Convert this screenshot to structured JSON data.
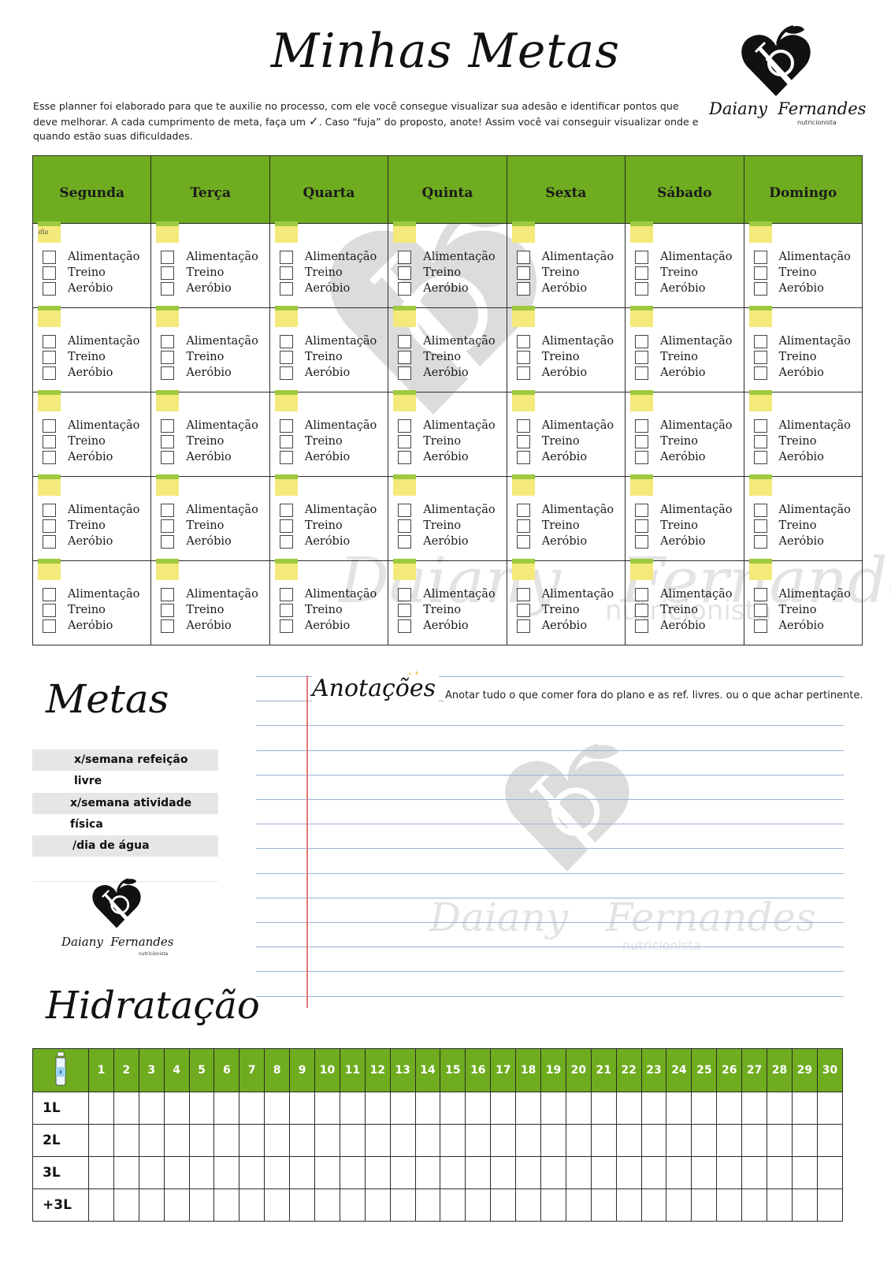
{
  "title": "Minhas Metas",
  "intro": {
    "part1": "Esse planner foi elaborado para que te auxilie no processo, com ele você consegue visualizar sua adesão e identificar pontos que deve melhorar. A cada cumprimento de meta, faça um ",
    "check_icon": "checkmark-icon",
    "part2": ". Caso “fuja” do proposto, anote! Assim você vai conseguir visualizar onde e quando estão suas dificuldades."
  },
  "logo": {
    "first_name": "Daiany",
    "last_name": "Fernandes",
    "subtitle": "nutricionista",
    "icon": "heart-fork-knife-icon"
  },
  "week": {
    "days": [
      "Segunda",
      "Terça",
      "Quarta",
      "Quinta",
      "Sexta",
      "Sábado",
      "Domingo"
    ],
    "items": [
      "Alimentação",
      "Treino",
      "Aeróbio"
    ],
    "rows": 5,
    "day_tag": "dia"
  },
  "metas": {
    "title": "Metas",
    "goals": [
      "x/semana refeição livre",
      "x/semana atividade física",
      "/dia de água"
    ]
  },
  "anotacoes": {
    "title": "Anotações",
    "description": "Anotar tudo o que comer fora do plano e as ref. livres. ou o que achar pertinente."
  },
  "hidratacao": {
    "title": "Hidratação",
    "days": [
      "1",
      "2",
      "3",
      "4",
      "5",
      "6",
      "7",
      "8",
      "9",
      "10",
      "11",
      "12",
      "13",
      "14",
      "15",
      "16",
      "17",
      "18",
      "19",
      "20",
      "21",
      "22",
      "23",
      "24",
      "25",
      "26",
      "27",
      "28",
      "29",
      "30"
    ],
    "rows": [
      "1L",
      "2L",
      "3L",
      "+3L"
    ],
    "header_icon": "water-bottle-icon"
  },
  "colors": {
    "header_green": "#6fac1f",
    "note_yellow": "#f4e97b",
    "note_green": "#9fca3e",
    "metas_bar": "#e6e6e6",
    "notes_line": "#9bb2d6",
    "margin_line": "#e07a7a"
  }
}
